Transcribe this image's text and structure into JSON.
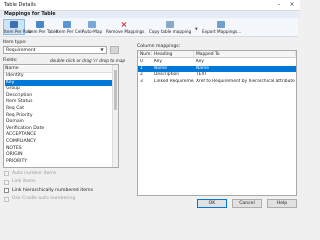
{
  "window": {
    "title": "Table Details"
  },
  "section": {
    "title": "Mappings for Table"
  },
  "toolbar": {
    "buttons": [
      {
        "label": "Item Per Row",
        "icon": "table-row-icon",
        "active": true
      },
      {
        "label": "Item Per Table",
        "icon": "table-icon"
      },
      {
        "label": "Item Per Cell",
        "icon": "table-cell-icon"
      },
      {
        "label": "Auto-Map",
        "icon": "auto-map-icon"
      },
      {
        "label": "Remove Mappings",
        "icon": "remove-icon"
      },
      {
        "label": "Copy table mapping",
        "icon": "copy-icon",
        "dropdown": true
      },
      {
        "label": "Export Mappings...",
        "icon": "export-icon"
      }
    ]
  },
  "item_type": {
    "label": "Item type:",
    "value": "Requirement"
  },
  "fields": {
    "label": "Fields:",
    "hint": "double-click or drag 'n' drop to map",
    "header": "Name",
    "items": [
      "Identity",
      "Key",
      "Group",
      "Description",
      "Item Status",
      "Req Cat",
      "Req Priority",
      "Domain",
      "Verification Date",
      "ACCEPTANCE",
      "COMPLIANCY",
      "NOTES",
      "ORIGIN",
      "PRIORITY"
    ],
    "selected": "Key"
  },
  "checkboxes": [
    {
      "label": "Auto number items",
      "enabled": false
    },
    {
      "label": "Link items",
      "enabled": false
    },
    {
      "label": "Link hierarchically numbered items",
      "enabled": true
    },
    {
      "label": "Use Cradle auto numbering",
      "enabled": false
    }
  ],
  "column_mappings": {
    "label": "Column mappings:",
    "headers": [
      "Num",
      "Heading",
      "Mapped To"
    ],
    "rows": [
      {
        "num": "0",
        "heading": "Key",
        "mapped": "Key"
      },
      {
        "num": "1",
        "heading": "Name",
        "mapped": "Name"
      },
      {
        "num": "2",
        "heading": "Description",
        "mapped": "TEXT"
      },
      {
        "num": "3",
        "heading": "Linked Requirements",
        "mapped": "Xref to Requirement by hierarchical attribute"
      }
    ],
    "selected_row": 1
  },
  "buttons": {
    "ok": "OK",
    "cancel": "Cancel",
    "help": "Help"
  },
  "colors": {
    "selection": "#0078d7",
    "band": "#e6ecf5"
  }
}
